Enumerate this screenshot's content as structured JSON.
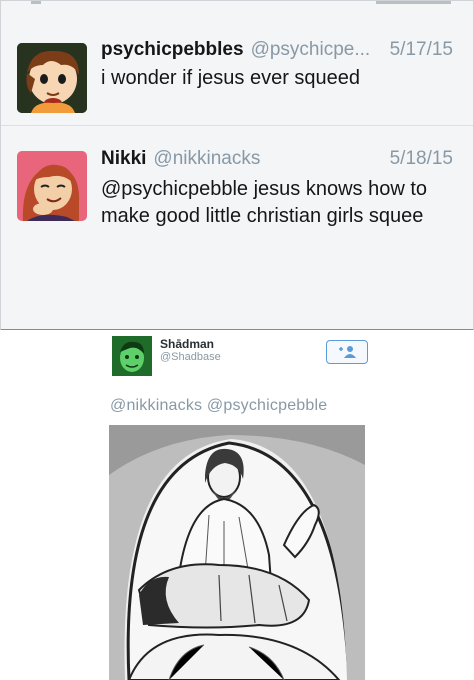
{
  "thread": {
    "tweets": [
      {
        "name": "psychicpebbles",
        "handle": "@psychicpe...",
        "date": "5/17/15",
        "text": "i wonder if jesus ever squeed"
      },
      {
        "name": "Nikki",
        "handle": "@nikkinacks",
        "date": "5/18/15",
        "text": "@psychicpebble jesus knows how to make good little christian girls squee"
      }
    ]
  },
  "reply": {
    "name": "Shādman",
    "handle": "@Shadbase",
    "mention1": "@nikkinacks",
    "mention2": "@psychicpebble",
    "follow_icon": "add-user-icon"
  },
  "colors": {
    "text": "#14171a",
    "muted": "#8899a6",
    "link_blue": "#5a9bd8"
  }
}
